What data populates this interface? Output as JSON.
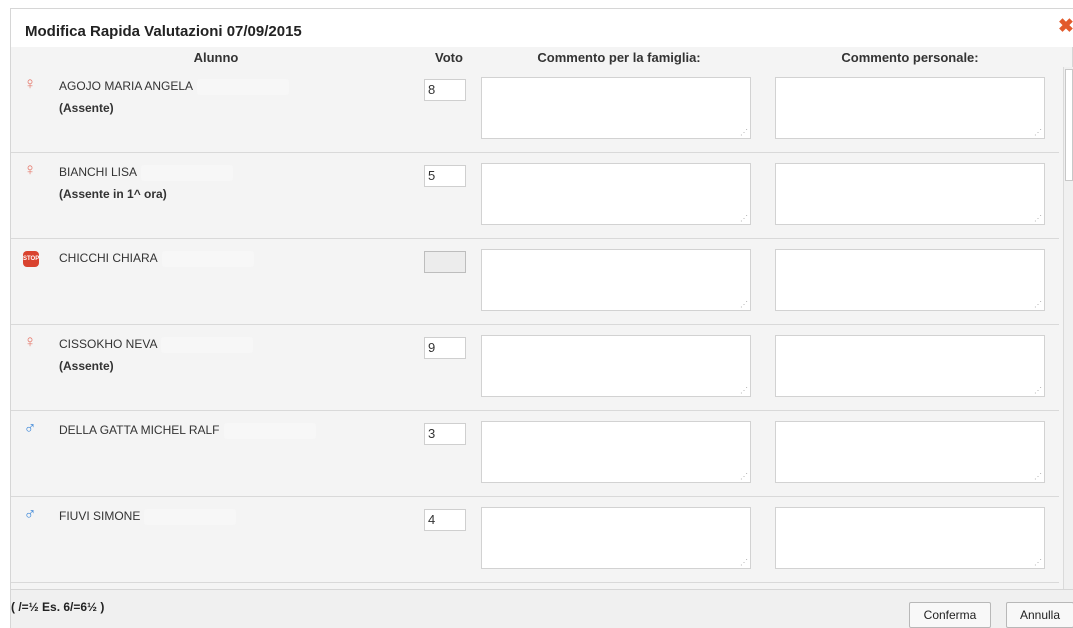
{
  "dialog": {
    "title": "Modifica Rapida Valutazioni 07/09/2015",
    "close_glyph": "✖"
  },
  "columns": {
    "alunno": "Alunno",
    "voto": "Voto",
    "famiglia": "Commento per la famiglia:",
    "personale": "Commento personale:"
  },
  "students": [
    {
      "name": "AGOJO MARIA ANGELA",
      "status": "(Assente)",
      "grade": "8",
      "gender_icon": "female-icon",
      "glyph": "♀"
    },
    {
      "name": "BIANCHI LISA",
      "status": "(Assente in 1^ ora)",
      "grade": "5",
      "gender_icon": "female-icon",
      "glyph": "♀"
    },
    {
      "name": "CHICCHI CHIARA",
      "status": "",
      "grade": "",
      "gender_icon": "stop-icon",
      "glyph": "STOP"
    },
    {
      "name": "CISSOKHO NEVA",
      "status": "(Assente)",
      "grade": "9",
      "gender_icon": "female-icon",
      "glyph": "♀"
    },
    {
      "name": "DELLA GATTA MICHEL RALF",
      "status": "",
      "grade": "3",
      "gender_icon": "male-icon",
      "glyph": "♂"
    },
    {
      "name": "FIUVI SIMONE",
      "status": "",
      "grade": "4",
      "gender_icon": "male-icon",
      "glyph": "♂"
    }
  ],
  "footer": {
    "legend": "( /=½ Es. 6/=6½ )",
    "confirm_label": "Conferma",
    "cancel_label": "Annulla"
  },
  "colors": {
    "female": "#e5776a",
    "male": "#3a86d8",
    "stop": "#d9432f",
    "close": "#e25a2b"
  }
}
